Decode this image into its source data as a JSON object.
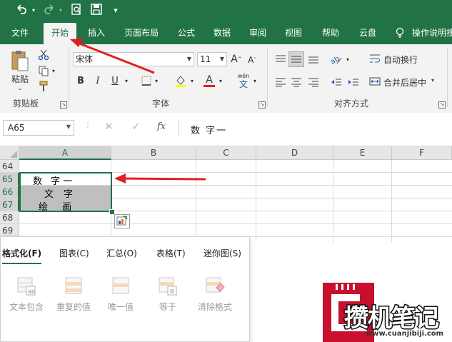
{
  "qat": {
    "undo_icon": "undo-icon",
    "redo_icon": "redo-icon",
    "preview_icon": "print-preview-icon",
    "save_icon": "save-icon",
    "more_icon": "customize-qat-icon"
  },
  "tabs": [
    {
      "label": "文件"
    },
    {
      "label": "开始"
    },
    {
      "label": "插入"
    },
    {
      "label": "页面布局"
    },
    {
      "label": "公式"
    },
    {
      "label": "数据"
    },
    {
      "label": "审阅"
    },
    {
      "label": "视图"
    },
    {
      "label": "帮助"
    },
    {
      "label": "云盘"
    },
    {
      "label": "操作说明搜"
    }
  ],
  "ribbon": {
    "clipboard": {
      "paste_label": "粘贴",
      "group_label": "剪贴板"
    },
    "font": {
      "font_name": "宋体",
      "font_size": "11",
      "bold": "B",
      "italic": "I",
      "underline": "U",
      "grow": "A",
      "shrink": "A",
      "font_color_letter": "A",
      "wen": "wén",
      "wen_char": "文",
      "group_label": "字体"
    },
    "alignment": {
      "wrap_label": "自动换行",
      "merge_label": "合并后居中",
      "group_label": "对齐方式"
    }
  },
  "formula_bar": {
    "name_box": "A65",
    "fx": "fx",
    "content": "数 字一"
  },
  "columns": [
    "A",
    "B",
    "C",
    "D",
    "E",
    "F"
  ],
  "rows": [
    "64",
    "65",
    "66",
    "67",
    "68",
    "69"
  ],
  "cells": {
    "a65": "数 字一",
    "a66": "文 字",
    "a67": "绘 画"
  },
  "quick_analysis": {
    "tabs": [
      {
        "label": "格式化(F)"
      },
      {
        "label": "图表(C)"
      },
      {
        "label": "汇总(O)"
      },
      {
        "label": "表格(T)"
      },
      {
        "label": "迷你图(S)"
      }
    ],
    "items": [
      {
        "label": "文本包含"
      },
      {
        "label": "重复的值"
      },
      {
        "label": "唯一值"
      },
      {
        "label": "等于"
      },
      {
        "label": "清除格式"
      }
    ]
  },
  "watermark": {
    "title": "攒机笔记",
    "url": "www.cuanjibiji.com"
  },
  "colors": {
    "accent": "#217346",
    "annotation": "#e02020",
    "selection": "#bfbfbf"
  }
}
